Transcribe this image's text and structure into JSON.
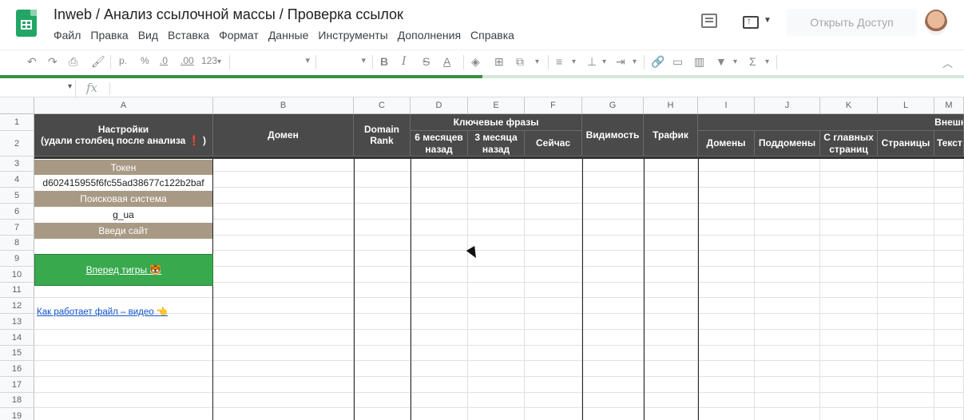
{
  "app": {
    "doc_title": "Inweb / Анализ ссылочной массы / Проверка ссылок",
    "menu": [
      "Файл",
      "Правка",
      "Вид",
      "Вставка",
      "Формат",
      "Данные",
      "Инструменты",
      "Дополнения",
      "Справка"
    ],
    "share_label": "Открыть Доступ"
  },
  "toolbar": {
    "currency": "р.",
    "percent": "%",
    "dec_decrease": ".0",
    "dec_increase": ".00",
    "format_more": "123",
    "bold": "B",
    "italic": "I",
    "strike": "S",
    "text_color": "A",
    "functions": "Σ"
  },
  "loading_progress": 0.5,
  "formula_bar": {
    "fx_label": "fx",
    "value": ""
  },
  "columns": [
    "A",
    "B",
    "C",
    "D",
    "E",
    "F",
    "G",
    "H",
    "I",
    "J",
    "K",
    "L",
    "M"
  ],
  "rows": [
    "1",
    "2",
    "3",
    "4",
    "5",
    "6",
    "7",
    "8",
    "9",
    "10",
    "11",
    "12",
    "13",
    "14",
    "15",
    "16",
    "17",
    "18",
    "19"
  ],
  "headers": {
    "settings_line1": "Настройки",
    "settings_line2": "(удали столбец после анализа",
    "settings_excl": "❗",
    "settings_close": ")",
    "domain": "Домен",
    "domain_rank": "Domain Rank",
    "keywords": "Ключевые фразы",
    "six_months": "6 месяцев назад",
    "three_months": "3 месяца назад",
    "now": "Сейчас",
    "visibility": "Видимость",
    "traffic": "Трафик",
    "external": "Внешн",
    "domains": "Домены",
    "subdomains": "Поддомены",
    "from_main": "С главных страниц",
    "pages": "Страницы",
    "text": "Текст"
  },
  "settings_panel": {
    "token_label": "Токен",
    "token_value": "d602415955f6fc55ad38677c122b2baf",
    "engine_label": "Поисковая система",
    "engine_value": "g_ua",
    "site_label": "Введи сайт",
    "site_value": "",
    "go_button": "Вперед тигры 🐯",
    "video_link": "Как работает файл – видео 👈"
  },
  "colors": {
    "header_dark": "#4a4a4a",
    "label_brown": "#a89985",
    "go_green": "#38a94d",
    "link_blue": "#1155cc",
    "sheets_green": "#23a566"
  }
}
